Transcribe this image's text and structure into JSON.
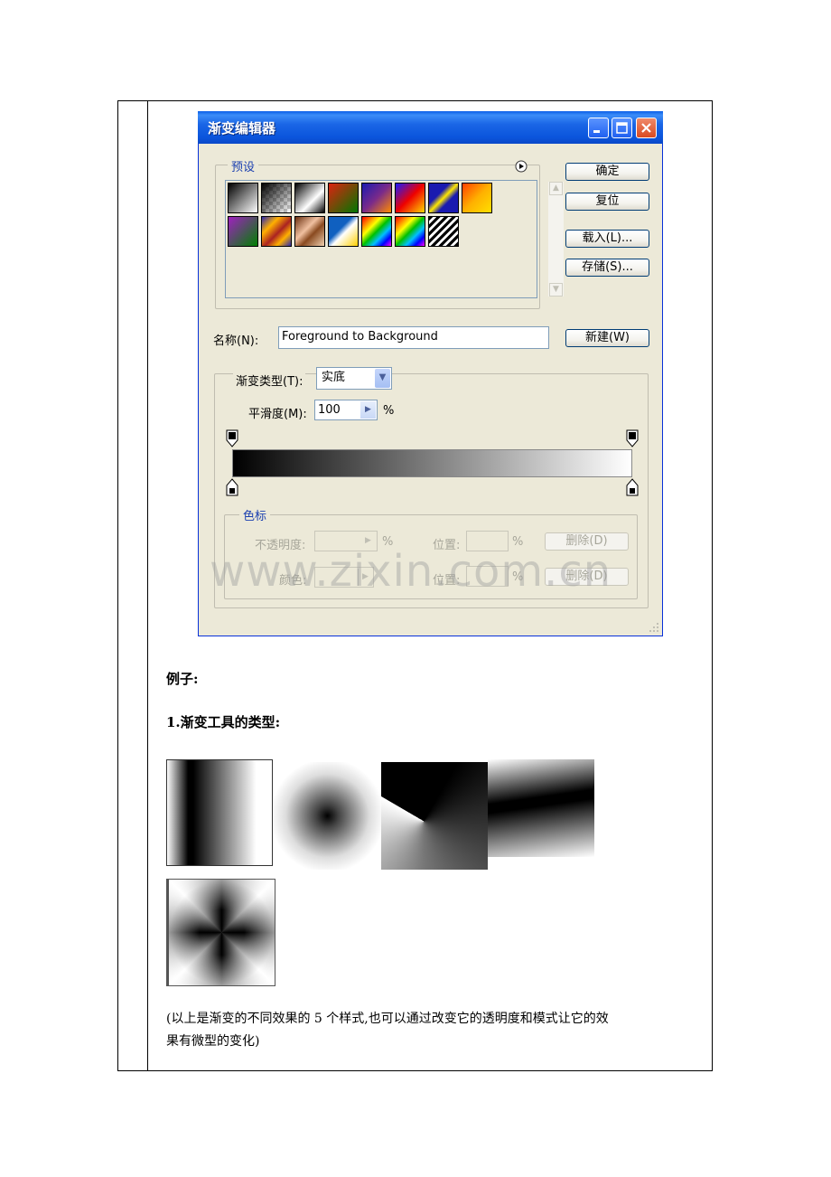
{
  "dialog": {
    "title": "渐变编辑器",
    "presets_label": "预设",
    "buttons": {
      "ok": "确定",
      "reset": "复位",
      "load": "载入(L)...",
      "save": "存储(S)...",
      "new": "新建(W)"
    },
    "name_label": "名称(N):",
    "name_value": "Foreground to Background",
    "gradient_type_label": "渐变类型(T):",
    "gradient_type_value": "实底",
    "smoothness_label": "平滑度(M):",
    "smoothness_value": "100",
    "percent": "%",
    "stops_group_label": "色标",
    "opacity_label": "不透明度:",
    "location_label": "位置:",
    "color_label": "颜色:",
    "delete_label": "删除(D)"
  },
  "watermark": "www.zixin.com.cn",
  "content": {
    "examples_heading": "例子:",
    "section_title": "1.渐变工具的类型:",
    "caption_line1": "(以上是渐变的不同效果的 5 个样式,也可以通过改变它的透明度和模式让它的效",
    "caption_line2": "果有微型的变化)"
  }
}
